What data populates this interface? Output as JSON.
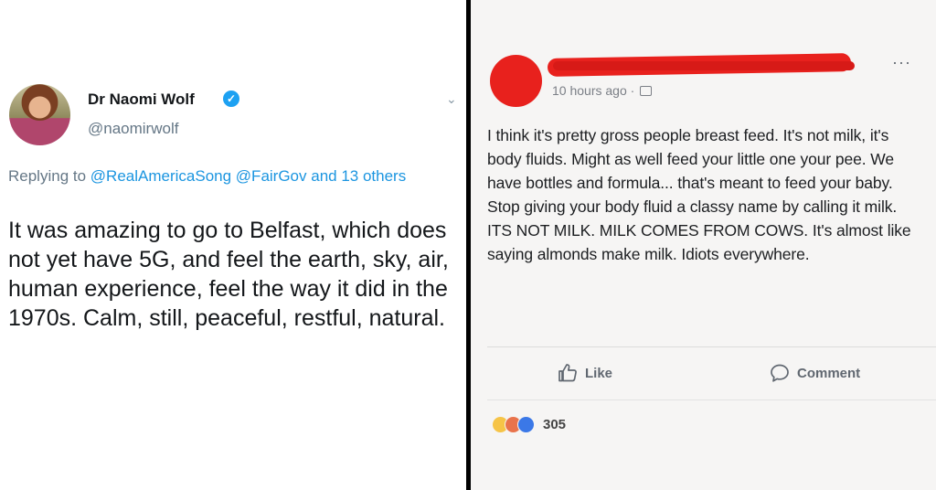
{
  "tweet": {
    "author_name": "Dr Naomi Wolf",
    "handle": "@naomirwolf",
    "verified_mark": "✓",
    "caret": "⌄",
    "replying_prefix": "Replying to ",
    "mentions": [
      "@RealAmericaSong",
      "@FairGov",
      "and 13 others"
    ],
    "text": "It was amazing to go to Belfast, which does not yet have 5G, and feel the earth, sky, air, human experience, feel the way it did in the 1970s. Calm, still, peaceful, restful, natural."
  },
  "facebook_post": {
    "timestamp": "10 hours ago ·",
    "more_label": "···",
    "text": "I think it's pretty gross people breast feed. It's not milk, it's body fluids. Might as well feed your little one your pee. We have bottles and formula... that's meant to feed your baby. Stop giving your body fluid a classy name by calling it milk. ITS NOT MILK. MILK COMES FROM COWS. It's almost like saying almonds make milk. Idiots everywhere.",
    "like_label": "Like",
    "comment_label": "Comment",
    "reaction_count": "305",
    "reactions": [
      "haha-icon",
      "angry-icon",
      "like-icon"
    ],
    "redaction_color": "#e8211d"
  },
  "colors": {
    "twitter_blue": "#1da1f2",
    "mention_blue": "#1b95e0",
    "divider": "#000000"
  }
}
